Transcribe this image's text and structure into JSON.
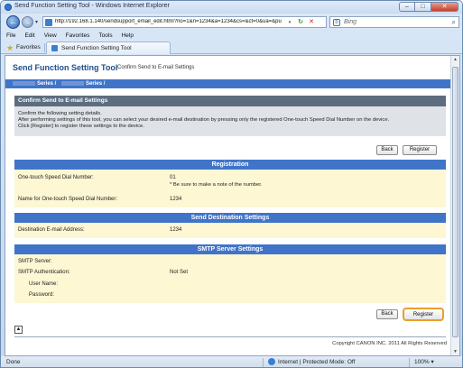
{
  "window": {
    "title": "Send Function Setting Tool - Windows Internet Explorer",
    "min": "–",
    "max": "□",
    "close": "✕"
  },
  "address": {
    "url": "http://192.168.1.140/sendsupport_email_edit.html?no=1&n=1234&a=1234&cs=&ct=0&ua=&pu",
    "search_engine": "Bing",
    "back": "←",
    "forward": "→",
    "dropdown": "▾",
    "refresh": "↻",
    "stop": "✕",
    "search_glyph": "⌕",
    "engine_glyph": "b"
  },
  "menu": [
    "File",
    "Edit",
    "View",
    "Favorites",
    "Tools",
    "Help"
  ],
  "favorites": {
    "label": "Favorites",
    "tab_title": "Send Function Setting Tool",
    "star_glyph": "★"
  },
  "page": {
    "tool_title": "Send Function Setting Tool",
    "subtitle": "Confirm Send to E-mail Settings",
    "breadcrumb_a": "Series /",
    "breadcrumb_b": "Series /",
    "panel": {
      "title": "Confirm Send to E-mail Settings",
      "line1": "Confirm the following setting details.",
      "line2": "After performing settings of this tool, you can select your desired e-mail destination by pressing only the registered One-touch Speed Dial Number on the device.",
      "line3": "Click [Register] to register these settings to the device."
    },
    "buttons": {
      "back": "Back",
      "register": "Register"
    },
    "registration": {
      "heading": "Registration",
      "speed_dial_label": "One-touch Speed Dial Number:",
      "speed_dial_value": "01",
      "note": "* Be sure to make a note of the number.",
      "name_label": "Name for One-touch Speed Dial Number:",
      "name_value": "1234"
    },
    "destination": {
      "heading": "Send Destination Settings",
      "email_label": "Destination E-mail Address:",
      "email_value": "1234"
    },
    "smtp": {
      "heading": "SMTP Server Settings",
      "server_label": "SMTP Server:",
      "auth_label": "SMTP Authentication:",
      "auth_value": "Not Set",
      "user_label": "User Name:",
      "password_label": "Password:"
    },
    "top_glyph": "▲",
    "copyright": "Copyright CANON INC. 2011 All Rights Reserved"
  },
  "status": {
    "done": "Done",
    "zone": "Internet | Protected Mode: Off",
    "zoom": "100%",
    "zoom_glyph": "▾"
  },
  "colors": {
    "accent_blue": "#3f74c9",
    "panel_header": "#5d6d80",
    "section_bg": "#fdf7d3",
    "highlight_orange": "#e8a02a"
  }
}
